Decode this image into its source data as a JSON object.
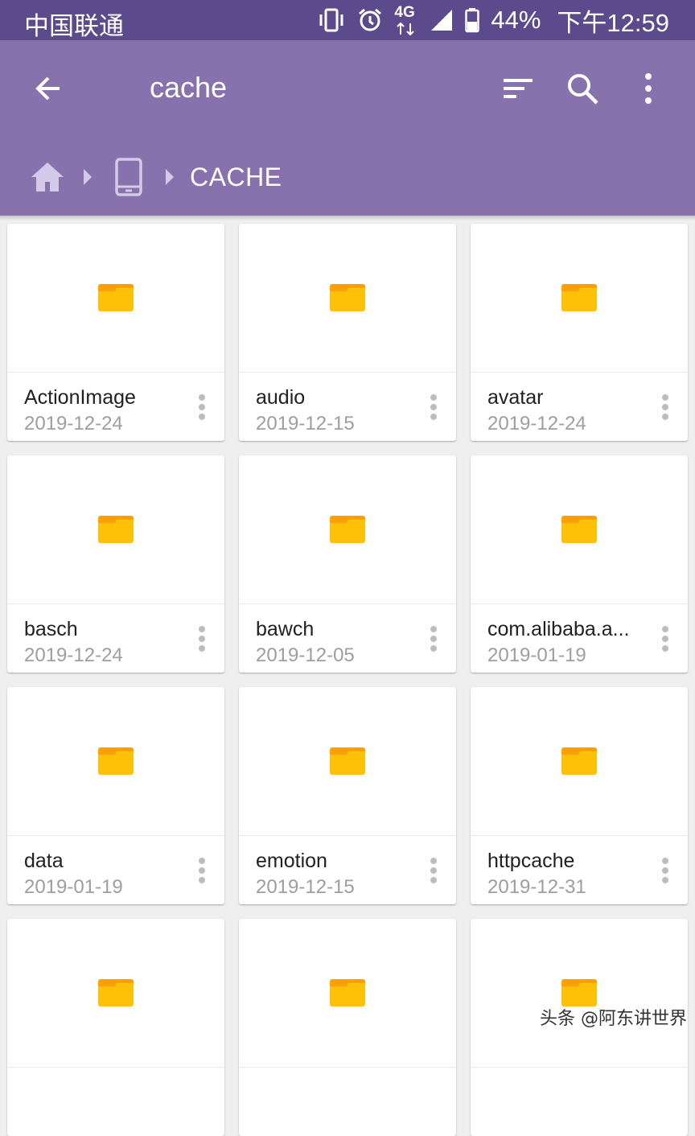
{
  "status_bar": {
    "carrier": "中国联通",
    "network": "4G",
    "battery": "44%",
    "time": "下午12:59",
    "icons": [
      "vibrate-icon",
      "alarm-icon",
      "network-4g-icon",
      "signal-icon",
      "battery-icon"
    ]
  },
  "app_bar": {
    "title": "cache",
    "icons": [
      "back-arrow-icon",
      "sort-icon",
      "search-icon",
      "more-vert-icon"
    ]
  },
  "breadcrumb": {
    "items": [
      "home-icon",
      "phone-icon"
    ],
    "current": "CACHE"
  },
  "folders": [
    {
      "name": "ActionImage",
      "date": "2019-12-24"
    },
    {
      "name": "audio",
      "date": "2019-12-15"
    },
    {
      "name": "avatar",
      "date": "2019-12-24"
    },
    {
      "name": "basch",
      "date": "2019-12-24"
    },
    {
      "name": "bawch",
      "date": "2019-12-05"
    },
    {
      "name": "com.alibaba.a...",
      "date": "2019-01-19"
    },
    {
      "name": "data",
      "date": "2019-01-19"
    },
    {
      "name": "emotion",
      "date": "2019-12-15"
    },
    {
      "name": "httpcache",
      "date": "2019-12-31"
    },
    {
      "name": "",
      "date": ""
    },
    {
      "name": "",
      "date": ""
    },
    {
      "name": "",
      "date": ""
    }
  ],
  "colors": {
    "status_bar": "#5b4a8c",
    "app_bar": "#8772ae",
    "folder": "#ffc107",
    "folder_tab": "#ffa000"
  },
  "watermark": "头条 @阿东讲世界"
}
